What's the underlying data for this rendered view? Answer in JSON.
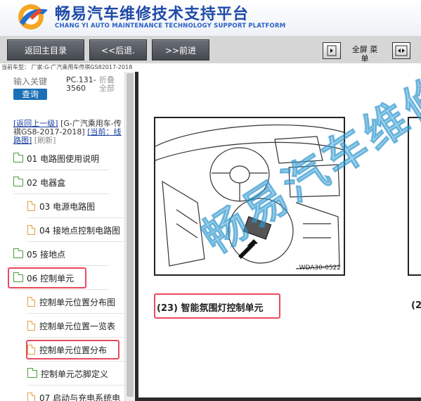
{
  "header": {
    "title": "畅易汽车维修技术支持平台",
    "subtitle": "CHANG YI AUTO MAINTENANCE TECHNOLOGY SUPPORT PLATFORM"
  },
  "toolbar": {
    "home_label": "返回主目录",
    "back_label": "<<后退.",
    "forward_label": ">>前进",
    "fullscreen_label": "全屏 菜单"
  },
  "car_line": "当前车型： 厂家:G-广汽乘用车传祺GS82017-2018",
  "search": {
    "placeholder": "输入关键",
    "button_label": "查询",
    "code": "PC.131-3560",
    "collapse_label": "折叠全部"
  },
  "nav": {
    "up_link": "[返回上一级]",
    "model": "[G-广汽乘用车-传祺GS8-2017-2018]",
    "current": "[当前：线路图]",
    "refresh": "[刷新]"
  },
  "tree": [
    {
      "label": "01 电路图使用说明"
    },
    {
      "label": "02 电器盒"
    },
    {
      "label": "03 电源电路图"
    },
    {
      "label": "04 接地点控制电路图"
    },
    {
      "label": "05 接地点"
    },
    {
      "label": "06 控制单元"
    },
    {
      "label": "控制单元位置分布图"
    },
    {
      "label": "控制单元位置一览表"
    },
    {
      "label": "控制单元位置分布"
    },
    {
      "label": "控制单元芯脚定义"
    },
    {
      "label": "07 启动与充电系统电"
    }
  ],
  "content": {
    "figure_code": "WDA30-0522",
    "caption": "(23) 智能氛围灯控制单元",
    "caption2": "(2",
    "watermark": "畅易汽车维修"
  },
  "colors": {
    "accent": "#1f4aa8",
    "highlight": "#e84a5f",
    "toolbar_button": "#454950",
    "query_button": "#1a6fb5"
  }
}
